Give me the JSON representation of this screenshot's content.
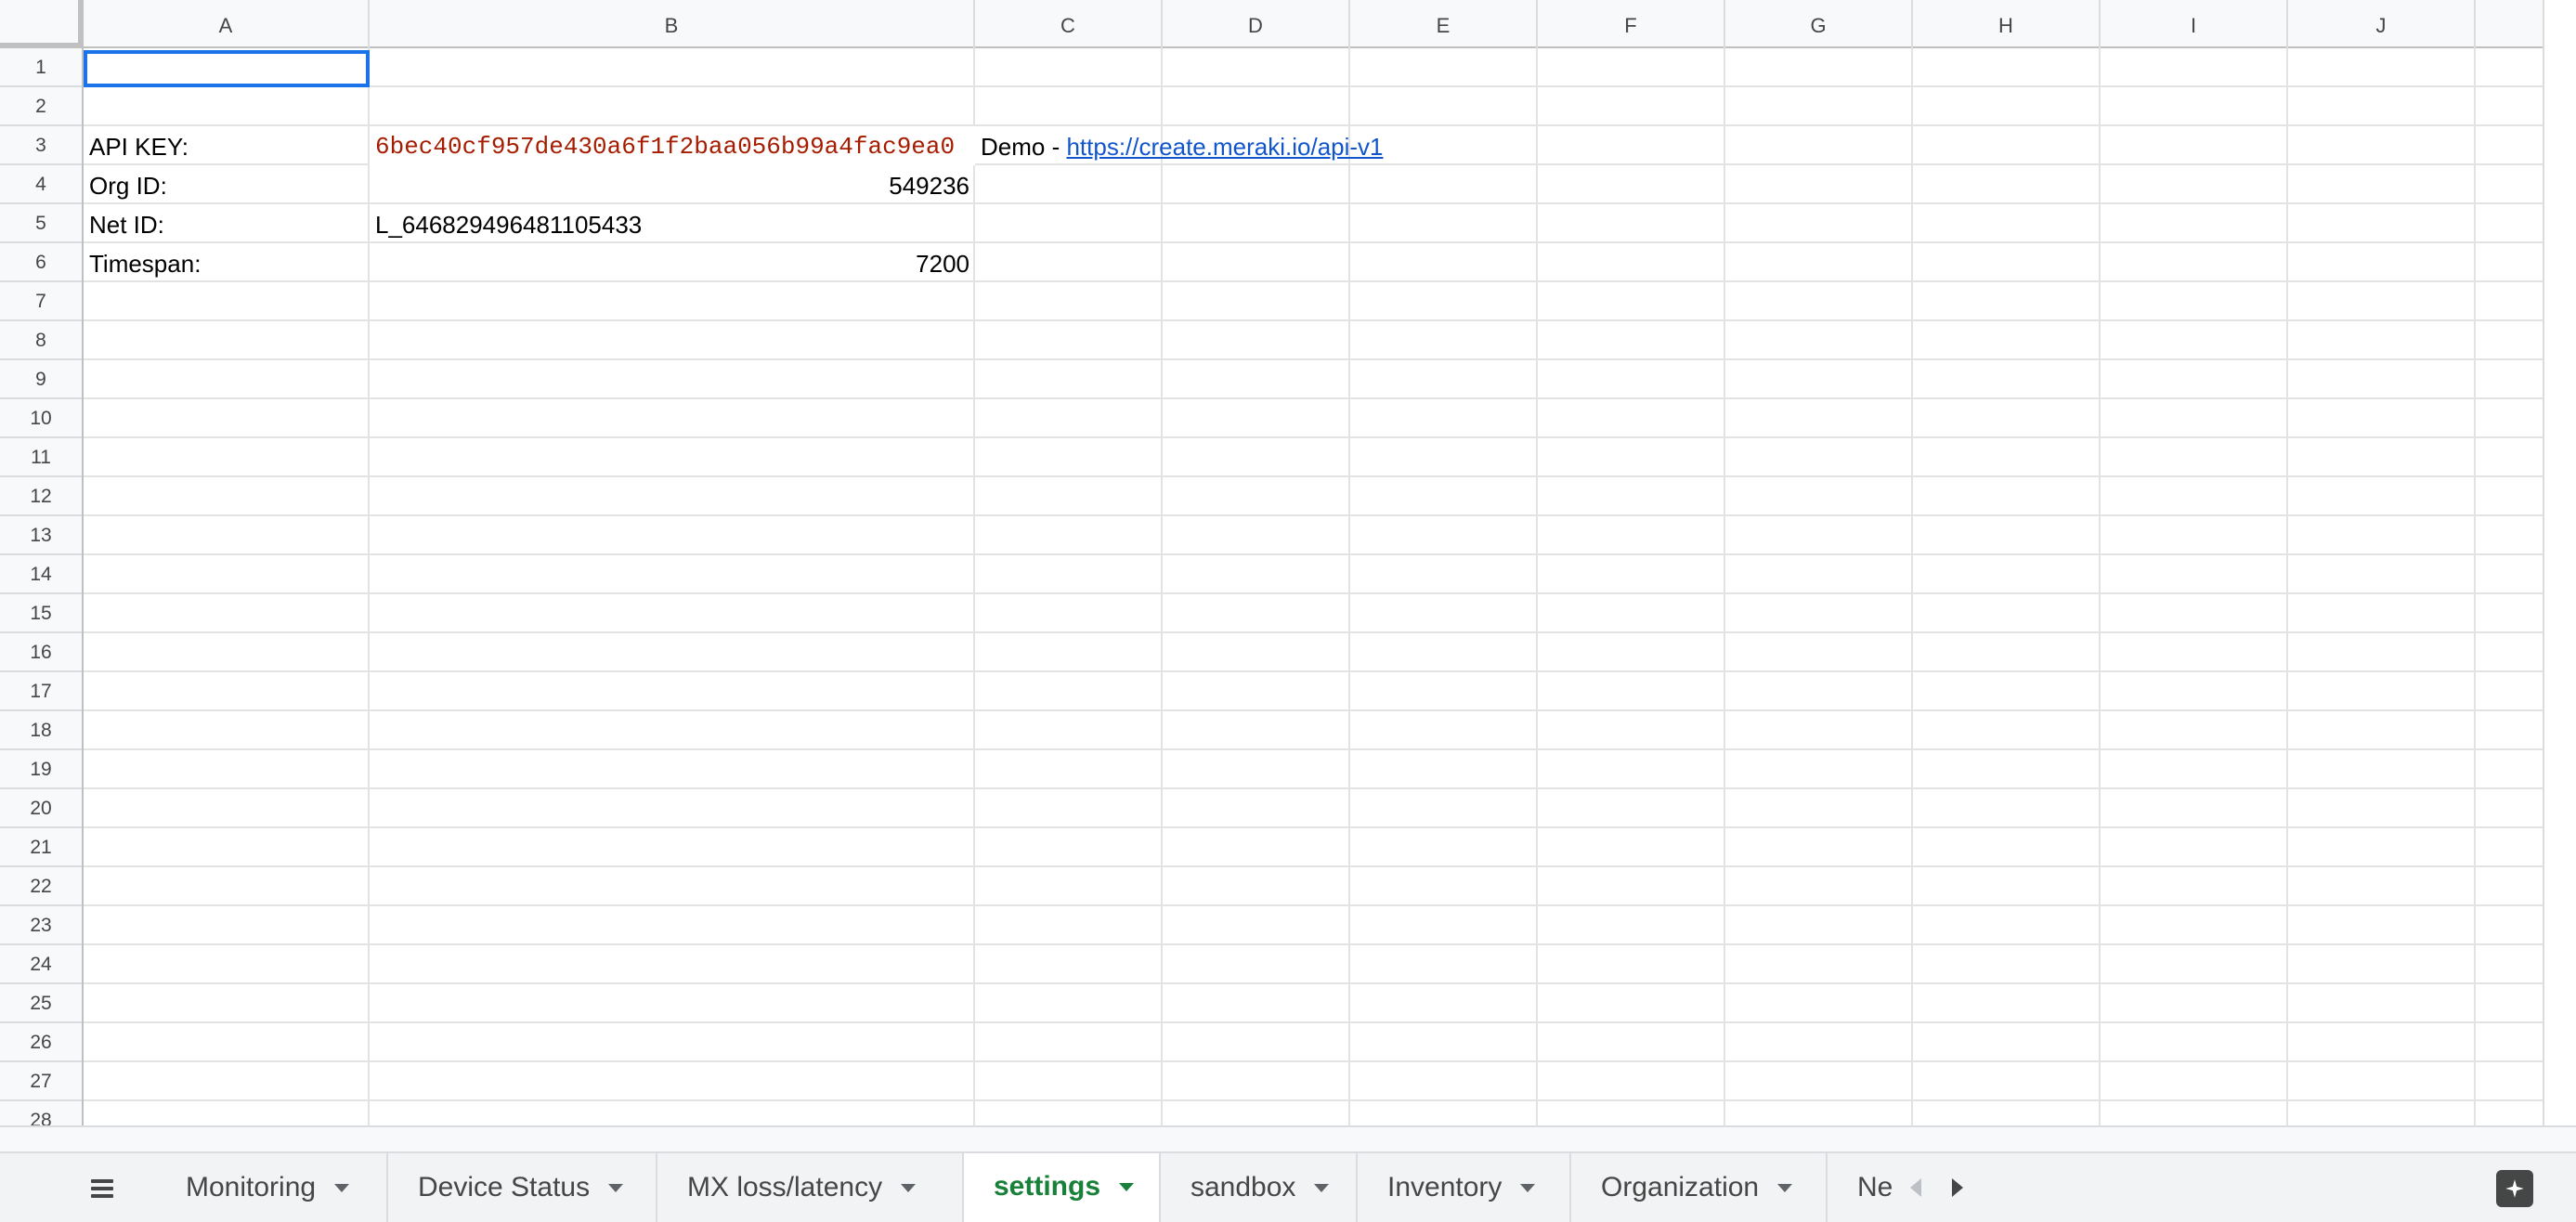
{
  "columns": [
    "A",
    "B",
    "C",
    "D",
    "E",
    "F",
    "G",
    "H",
    "I",
    "J"
  ],
  "rows": [
    "1",
    "2",
    "3",
    "4",
    "5",
    "6",
    "7",
    "8",
    "9",
    "10",
    "11",
    "12",
    "13",
    "14",
    "15",
    "16",
    "17",
    "18",
    "19",
    "20",
    "21",
    "22",
    "23",
    "24",
    "25",
    "26",
    "27",
    "28"
  ],
  "cells": {
    "a3": "API KEY:",
    "b3": "6bec40cf957de430a6f1f2baa056b99a4fac9ea0",
    "c3_prefix": "Demo - ",
    "c3_link": "https://create.meraki.io/api-v1",
    "a4": "Org ID:",
    "b4": "549236",
    "a5": "Net ID:",
    "b5": "L_646829496481105433",
    "a6": "Timespan:",
    "b6": "7200"
  },
  "tabs": [
    {
      "label": "Monitoring",
      "active": false
    },
    {
      "label": "Device Status",
      "active": false
    },
    {
      "label": "MX loss/latency",
      "active": false
    },
    {
      "label": "settings",
      "active": true
    },
    {
      "label": "sandbox",
      "active": false
    },
    {
      "label": "Inventory",
      "active": false
    },
    {
      "label": "Organization",
      "active": false
    },
    {
      "label": "Net",
      "active": false
    }
  ],
  "colors": {
    "active_tab": "#188038",
    "selection": "#1a73e8",
    "api_key_text": "#a61c00",
    "link": "#1155cc"
  },
  "icons": {
    "all_sheets": "menu-lines-icon",
    "explore": "explore-sparkle-icon"
  }
}
